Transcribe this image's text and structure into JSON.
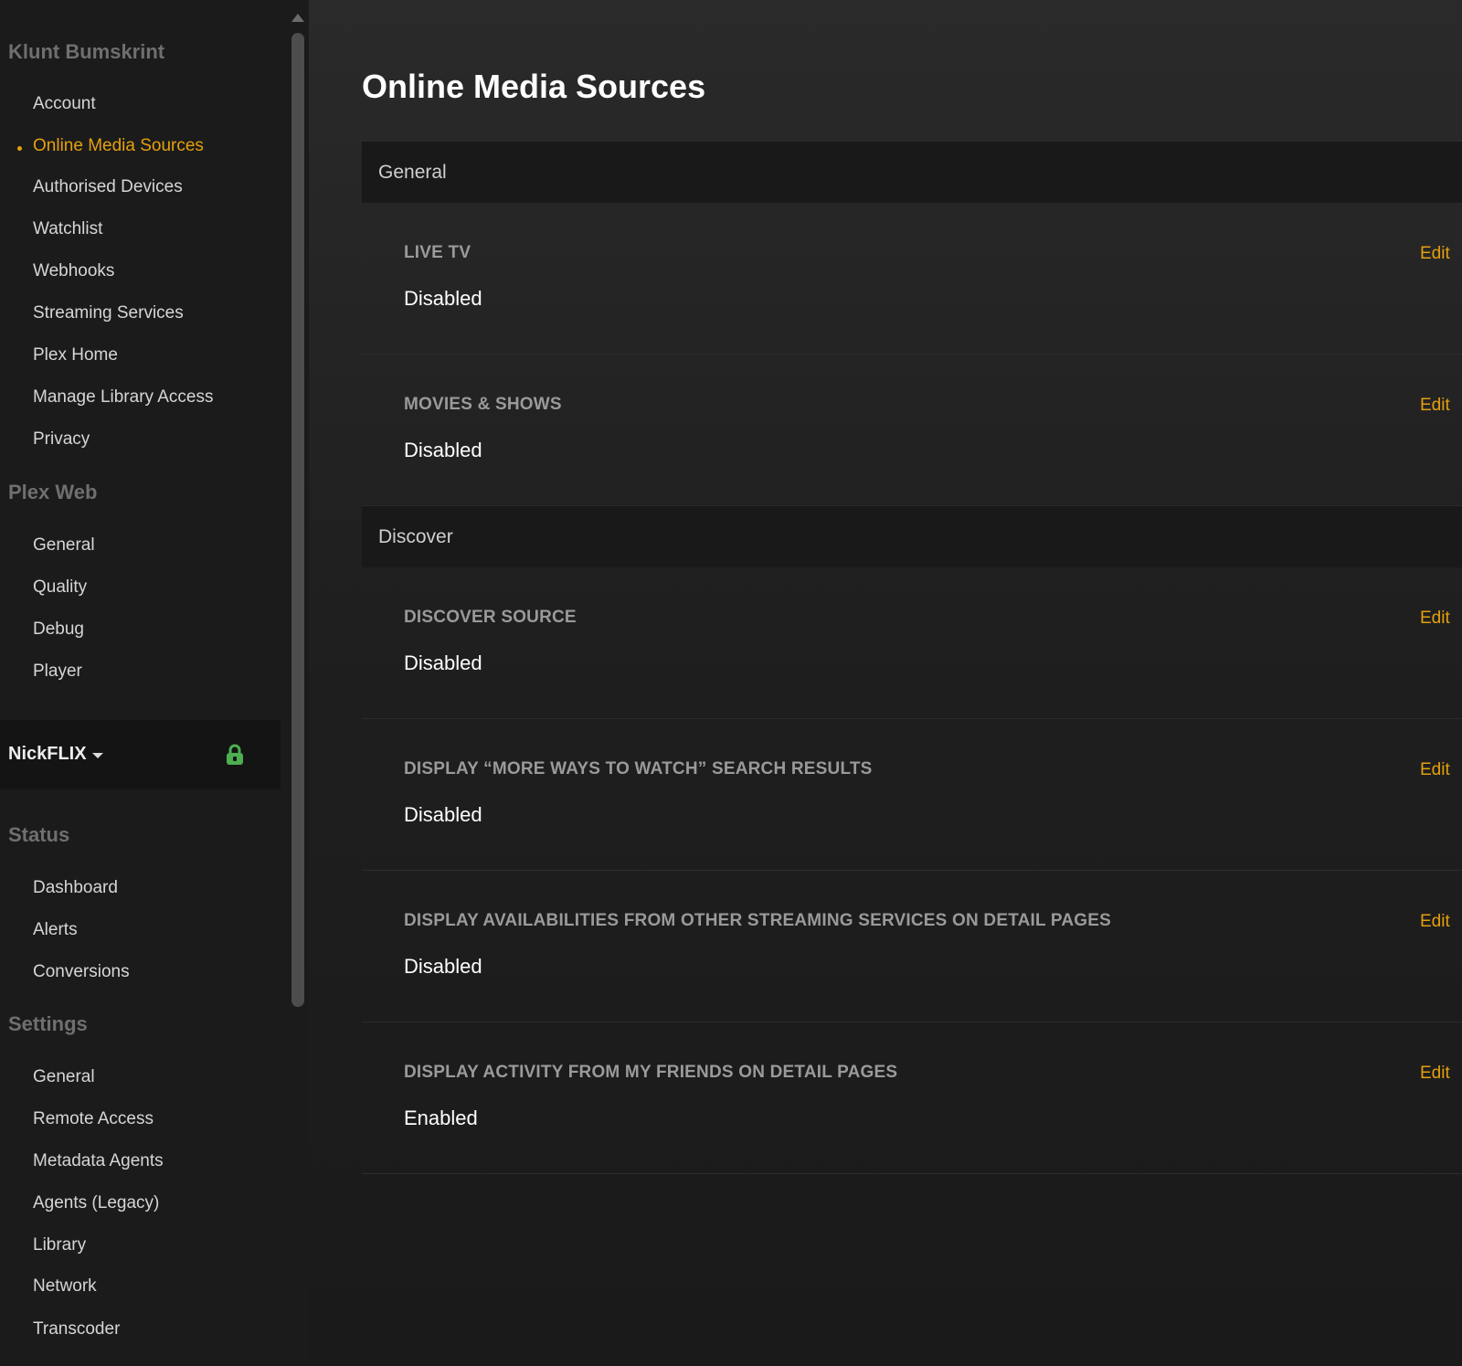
{
  "sidebar": {
    "account_title": "Klunt Bumskrint",
    "account_items": [
      {
        "label": "Account"
      },
      {
        "label": "Online Media Sources"
      },
      {
        "label": "Authorised Devices"
      },
      {
        "label": "Watchlist"
      },
      {
        "label": "Webhooks"
      },
      {
        "label": "Streaming Services"
      },
      {
        "label": "Plex Home"
      },
      {
        "label": "Manage Library Access"
      },
      {
        "label": "Privacy"
      }
    ],
    "active_item": "Online Media Sources",
    "plexweb_title": "Plex Web",
    "plexweb_items": [
      {
        "label": "General"
      },
      {
        "label": "Quality"
      },
      {
        "label": "Debug"
      },
      {
        "label": "Player"
      }
    ],
    "server": {
      "name": "NickFLIX",
      "lock_color": "#4caf50"
    },
    "status_title": "Status",
    "status_items": [
      {
        "label": "Dashboard"
      },
      {
        "label": "Alerts"
      },
      {
        "label": "Conversions"
      }
    ],
    "settings_title": "Settings",
    "settings_items": [
      {
        "label": "General"
      },
      {
        "label": "Remote Access"
      },
      {
        "label": "Metadata Agents"
      },
      {
        "label": "Agents (Legacy)"
      },
      {
        "label": "Library"
      },
      {
        "label": "Network"
      },
      {
        "label": "Transcoder"
      }
    ]
  },
  "main": {
    "title": "Online Media Sources",
    "groups": [
      {
        "header": "General",
        "settings": [
          {
            "label": "LIVE TV",
            "value": "Disabled",
            "action": "Edit"
          },
          {
            "label": "MOVIES & SHOWS",
            "value": "Disabled",
            "action": "Edit"
          }
        ]
      },
      {
        "header": "Discover",
        "settings": [
          {
            "label": "DISCOVER SOURCE",
            "value": "Disabled",
            "action": "Edit"
          },
          {
            "label": "DISPLAY “MORE WAYS TO WATCH” SEARCH RESULTS",
            "value": "Disabled",
            "action": "Edit"
          },
          {
            "label": "DISPLAY AVAILABILITIES FROM OTHER STREAMING SERVICES ON DETAIL PAGES",
            "value": "Disabled",
            "action": "Edit"
          },
          {
            "label": "DISPLAY ACTIVITY FROM MY FRIENDS ON DETAIL PAGES",
            "value": "Enabled",
            "action": "Edit"
          }
        ]
      }
    ]
  },
  "colors": {
    "accent": "#e5a00d",
    "background": "#1f1f1f",
    "sidebar": "#1b1b1b"
  }
}
